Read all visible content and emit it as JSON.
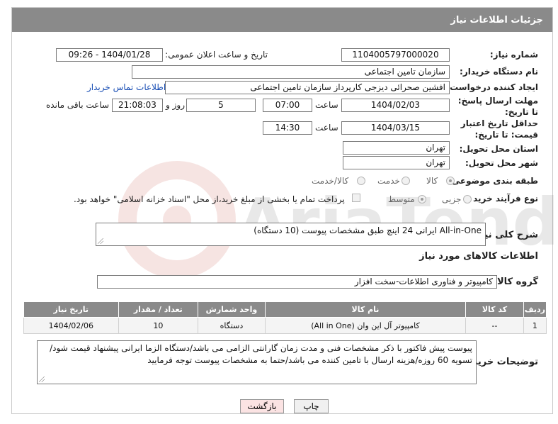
{
  "header": {
    "title": "جزئیات اطلاعات نیاز"
  },
  "fields": {
    "need_number_label": "شماره نیاز:",
    "need_number": "1104005797000020",
    "announce_label": "تاریخ و ساعت اعلان عمومی:",
    "announce_value": "1404/01/28 - 09:26",
    "buyer_org_label": "نام دستگاه خریدار:",
    "buyer_org": "سازمان تامین اجتماعی",
    "requester_label": "ایجاد کننده درخواست:",
    "requester": "افشین صحرائی دیزجی کارپرداز سازمان تامین اجتماعی",
    "contact_link": "اطلاعات تماس خریدار",
    "reply_deadline_label": "مهلت ارسال پاسخ: تا تاریخ:",
    "reply_date": "1404/02/03",
    "time_label": "ساعت",
    "reply_time": "07:00",
    "days_value": "5",
    "days_label": "روز و",
    "remaining_time": "21:08:03",
    "remaining_label": "ساعت باقی مانده",
    "price_validity_label": "حداقل تاریخ اعتبار قیمت: تا تاریخ:",
    "validity_date": "1404/03/15",
    "validity_time": "14:30",
    "province_label": "استان محل تحویل:",
    "province": "تهران",
    "city_label": "شهر محل تحویل:",
    "city": "تهران",
    "category_label": "طبقه بندی موضوعی:",
    "category_options": [
      "کالا",
      "خدمت",
      "کالا/خدمت"
    ],
    "process_label": "نوع فرآیند خرید :",
    "process_options": [
      "جزیی",
      "متوسط"
    ],
    "payment_note": "پرداخت تمام یا بخشی از مبلغ خرید،از محل \"اسناد خزانه اسلامی\" خواهد بود."
  },
  "summary": {
    "label": "شرح کلی نیاز:",
    "value": "All-in-One ایرانی 24 اینچ طبق مشخصات پیوست (10 دستگاه)"
  },
  "goods": {
    "section_title": "اطلاعات کالاهای مورد نیاز",
    "group_label": "گروه کالا:",
    "group_value": "کامپیوتر و فناوری اطلاعات-سخت افزار",
    "columns": [
      "ردیف",
      "کد کالا",
      "نام کالا",
      "واحد شمارش",
      "تعداد / مقدار",
      "تاریخ نیاز"
    ],
    "rows": [
      {
        "row": "1",
        "code": "--",
        "name": "کامپیوتر آل این وان (All in One)",
        "unit": "دستگاه",
        "qty": "10",
        "date": "1404/02/06"
      }
    ]
  },
  "notes": {
    "label": "توضیحات خریدار:",
    "value": "پیوست پیش فاکتور با ذکر مشخصات فنی و مدت زمان گارانتی الزامی می باشد/دستگاه الزما ایرانی پیشنهاد قیمت شود/تسویه 60 روزه/هزینه ارسال با تامین کننده می باشد/حتما به مشخصات پیوست توجه فرمایید"
  },
  "buttons": {
    "print": "چاپ",
    "back": "بازگشت"
  },
  "colors": {
    "header_bg": "#8a8a8a",
    "link": "#1a4fb5",
    "back_button_bg": "#fbe3e3"
  }
}
